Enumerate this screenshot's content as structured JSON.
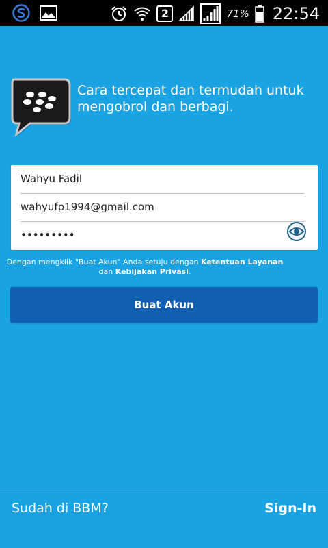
{
  "status_bar": {
    "sim_number": "2",
    "battery_percent": "71%",
    "time": "22:54",
    "icons": [
      "s-app-icon",
      "gallery-icon",
      "alarm-icon",
      "wifi-icon",
      "sim-2-icon",
      "signal-icon",
      "signal-box-icon",
      "battery-icon"
    ]
  },
  "header": {
    "tagline": "Cara tercepat dan termudah untuk mengobrol dan berbagi."
  },
  "form": {
    "name_value": "Wahyu Fadil",
    "email_value": "wahyufp1994@gmail.com",
    "password_value": "•••••••••"
  },
  "terms": {
    "prefix": "Dengan mengklik \"Buat Akun\" Anda setuju dengan ",
    "tos_link": "Ketentuan Layanan",
    "middle": "dan ",
    "privacy_link": "Kebijakan Privasi",
    "suffix": "."
  },
  "actions": {
    "create_account": "Buat Akun"
  },
  "footer": {
    "question": "Sudah di BBM?",
    "sign_in": "Sign-In"
  },
  "colors": {
    "background": "#1aa3e3",
    "button": "#115fb0",
    "status_bar": "#000000"
  }
}
